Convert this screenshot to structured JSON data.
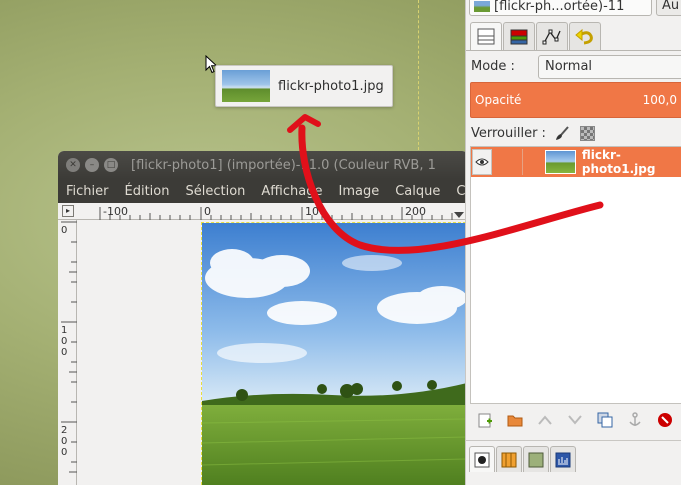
{
  "drag": {
    "label": "flickr-photo1.jpg"
  },
  "image_window": {
    "title": "[flickr-photo1] (importée)-11.0 (Couleur RVB, 1",
    "menu": [
      "Fichier",
      "Édition",
      "Sélection",
      "Affichage",
      "Image",
      "Calque",
      "C"
    ],
    "ruler_h": [
      "-100",
      "0",
      "100",
      "200"
    ],
    "ruler_v": [
      "0",
      "1\n0\n0",
      "2\n0\n0"
    ]
  },
  "dock": {
    "image_select": "[flickr-ph...ortée)-11",
    "auto_button": "Au",
    "mode_label": "Mode :",
    "mode_value": "Normal",
    "opacity_label": "Opacité",
    "opacity_value": "100,0",
    "lock_label": "Verrouiller :",
    "layer": {
      "name": "flickr-photo1.jpg"
    }
  },
  "colors": {
    "accent": "#f07746",
    "titlebar": "#3c3b37",
    "annotation_arrow": "#e0101a"
  }
}
